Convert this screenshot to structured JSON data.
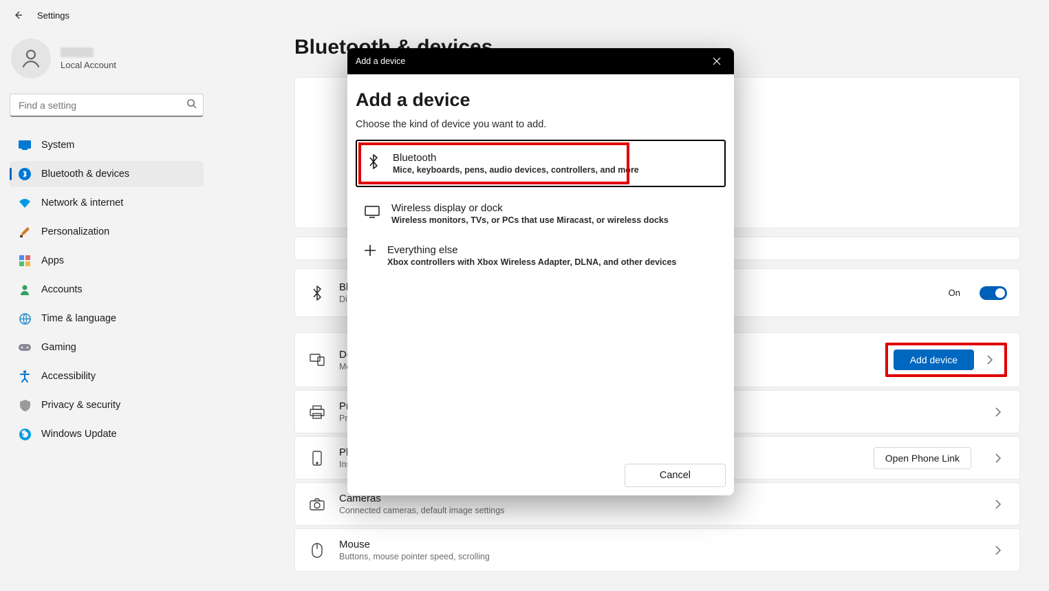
{
  "topbar": {
    "title": "Settings"
  },
  "account": {
    "sub": "Local Account"
  },
  "search": {
    "placeholder": "Find a setting"
  },
  "sidebar": {
    "items": [
      {
        "label": "System"
      },
      {
        "label": "Bluetooth & devices"
      },
      {
        "label": "Network & internet"
      },
      {
        "label": "Personalization"
      },
      {
        "label": "Apps"
      },
      {
        "label": "Accounts"
      },
      {
        "label": "Time & language"
      },
      {
        "label": "Gaming"
      },
      {
        "label": "Accessibility"
      },
      {
        "label": "Privacy & security"
      },
      {
        "label": "Windows Update"
      }
    ]
  },
  "page": {
    "title": "Bluetooth & devices"
  },
  "rows": {
    "bluetooth": {
      "title": "Bluetooth",
      "sub": "Discoverable",
      "toggleLabel": "On"
    },
    "devices": {
      "title": "Devices",
      "sub": "Mouse, keyboard, pen, audio, displays and docks, other devices",
      "button": "Add device"
    },
    "printers": {
      "title": "Printers & scanners",
      "sub": "Preferences, troubleshoot"
    },
    "phone": {
      "title": "Phone Link",
      "sub": "Instantly access your Android device's photos, texts, and more",
      "button": "Open Phone Link"
    },
    "cameras": {
      "title": "Cameras",
      "sub": "Connected cameras, default image settings"
    },
    "mouse": {
      "title": "Mouse",
      "sub": "Buttons, mouse pointer speed, scrolling"
    }
  },
  "modal": {
    "bar": "Add a device",
    "heading": "Add a device",
    "sub": "Choose the kind of device you want to add.",
    "options": [
      {
        "title": "Bluetooth",
        "desc": "Mice, keyboards, pens, audio devices, controllers, and more"
      },
      {
        "title": "Wireless display or dock",
        "desc": "Wireless monitors, TVs, or PCs that use Miracast, or wireless docks"
      },
      {
        "title": "Everything else",
        "desc": "Xbox controllers with Xbox Wireless Adapter, DLNA, and other devices"
      }
    ],
    "cancel": "Cancel"
  }
}
